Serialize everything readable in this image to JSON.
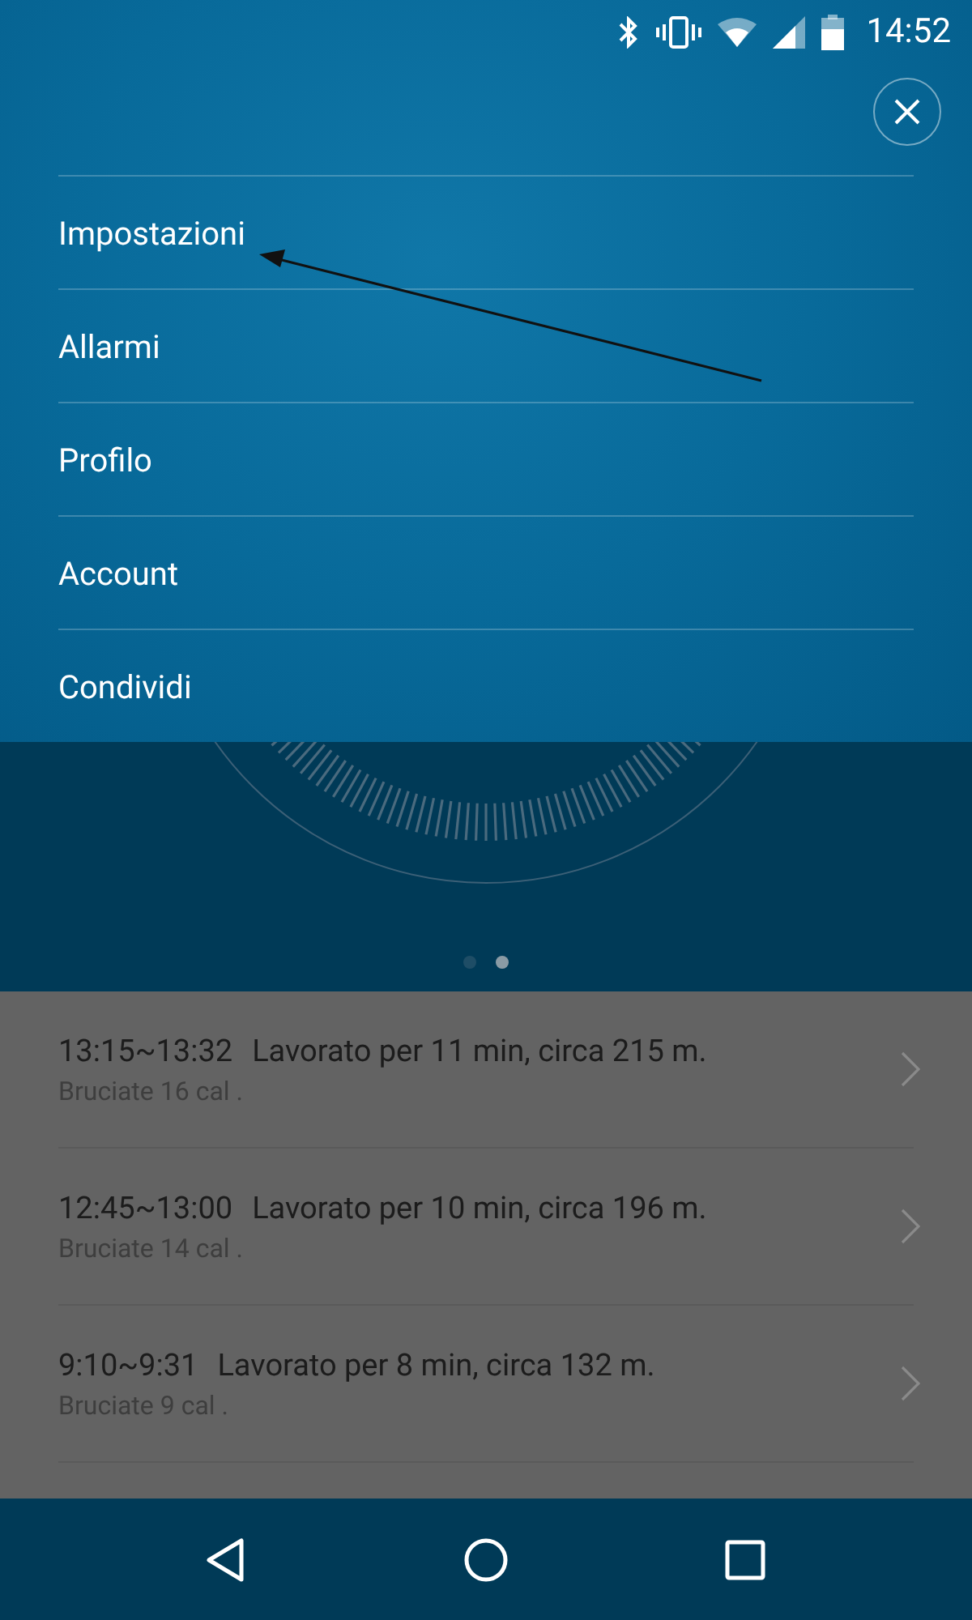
{
  "status_bar": {
    "time": "14:52"
  },
  "menu": {
    "items": [
      {
        "label": "Impostazioni"
      },
      {
        "label": "Allarmi"
      },
      {
        "label": "Profilo"
      },
      {
        "label": "Account"
      },
      {
        "label": "Condividi"
      }
    ]
  },
  "pager": [
    {
      "selected": false
    },
    {
      "selected": true
    }
  ],
  "activities": [
    {
      "time": "13:15~13:32",
      "summary": "Lavorato per 11 min, circa 215 m.",
      "calories": "Bruciate 16 cal ."
    },
    {
      "time": "12:45~13:00",
      "summary": "Lavorato per 10 min, circa 196 m.",
      "calories": "Bruciate 14 cal ."
    },
    {
      "time": "9:10~9:31",
      "summary": "Lavorato per 8 min, circa 132 m.",
      "calories": "Bruciate 9 cal ."
    }
  ]
}
